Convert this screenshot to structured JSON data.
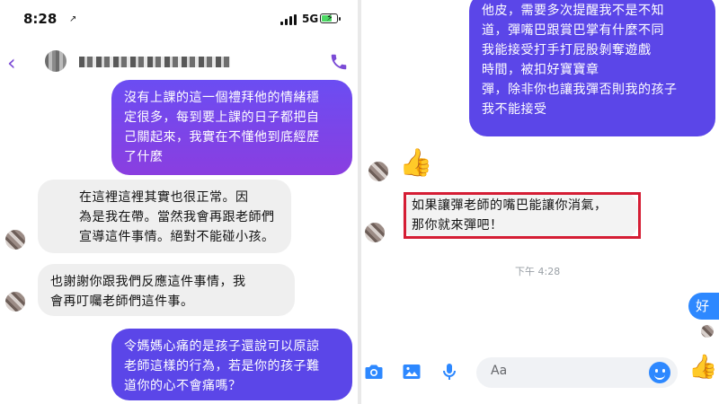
{
  "status_bar": {
    "time": "8:28",
    "location_arrow": "↗",
    "network": "5G"
  },
  "header": {
    "back_icon": "‹"
  },
  "left_messages": [
    {
      "text": "沒有上課的這一個禮拜他的情緒穩\n定很多，每到要上課的日子都把自\n己關起來，我實在不懂他到底經歷\n了什麼"
    },
    {
      "text": "在這裡這裡其實也很正常。因\n為是我在帶。當然我會再跟老師們\n宣導這件事情。絕對不能碰小孩。"
    },
    {
      "text": "也謝謝你跟我們反應這件事情，我\n會再叮囑老師們這件事。"
    },
    {
      "text": "令媽媽心痛的是孩子還說可以原諒\n老師這樣的行為，若是你的孩子難\n道你的心不會痛嗎？"
    }
  ],
  "right_messages": [
    {
      "text": "他皮，需要多次提醒我不是不知\n道，彈嘴巴跟賞巴掌有什麼不同\n我能接受打手打屁股剝奪遊戲\n時間，被扣好寶寶章\n彈，除非你也讓我彈否則我的孩子\n我不能接受"
    },
    {
      "text": "如果讓彈老師的嘴巴能讓你消氣，\n那你就來彈吧！"
    }
  ],
  "timestamp": "下午 4:28",
  "reply": "好",
  "composer": {
    "placeholder": "Aa"
  },
  "icons": {
    "like": "👍",
    "camera": "camera-icon",
    "photo": "photo-icon",
    "mic": "mic-icon"
  },
  "colors": {
    "accent": "#2d88ff",
    "purple": "#6b4df2",
    "highlight": "#d51d34"
  }
}
